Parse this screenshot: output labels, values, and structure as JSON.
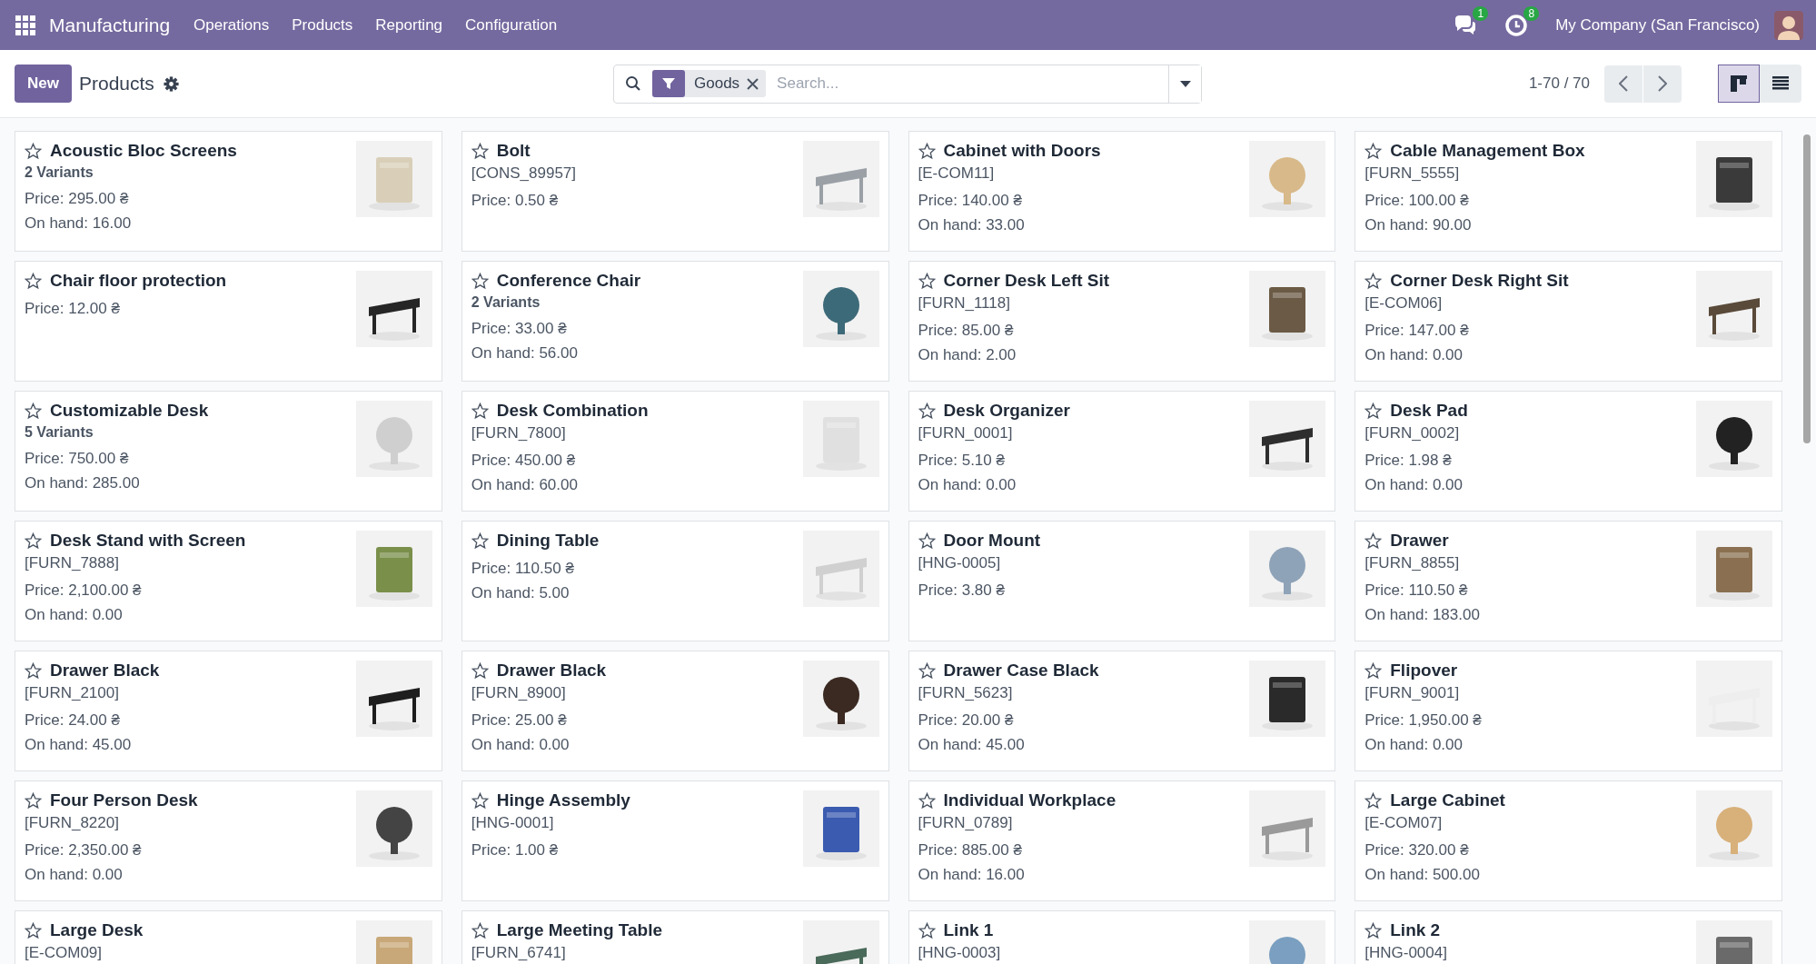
{
  "navbar": {
    "app_name": "Manufacturing",
    "menu": [
      "Operations",
      "Products",
      "Reporting",
      "Configuration"
    ],
    "messages_count": "1",
    "activities_count": "8",
    "company": "My Company (San Francisco)"
  },
  "control_panel": {
    "new_button": "New",
    "breadcrumb": "Products",
    "filter": "Goods",
    "search": {
      "placeholder": "Search..."
    },
    "pager": "1-70 / 70",
    "views": [
      {
        "kind": "kanban",
        "selected": true
      },
      {
        "kind": "list",
        "selected": false
      }
    ]
  },
  "products": [
    {
      "name": "Acoustic Bloc Screens",
      "variants": "2 Variants",
      "price": "Price: 295.00 ₴",
      "on_hand": "On hand: 16.00",
      "favorite": false
    },
    {
      "name": "Bolt",
      "code": "[CONS_89957]",
      "price": "Price: 0.50 ₴",
      "favorite": false
    },
    {
      "name": "Cabinet with Doors",
      "code": "[E-COM11]",
      "price": "Price: 140.00 ₴",
      "on_hand": "On hand: 33.00",
      "favorite": false
    },
    {
      "name": "Cable Management Box",
      "code": "[FURN_5555]",
      "price": "Price: 100.00 ₴",
      "on_hand": "On hand: 90.00",
      "favorite": false
    },
    {
      "name": "Chair floor protection",
      "price": "Price: 12.00 ₴",
      "favorite": false
    },
    {
      "name": "Conference Chair",
      "variants": "2 Variants",
      "price": "Price: 33.00 ₴",
      "on_hand": "On hand: 56.00",
      "favorite": false
    },
    {
      "name": "Corner Desk Left Sit",
      "code": "[FURN_1118]",
      "price": "Price: 85.00 ₴",
      "on_hand": "On hand: 2.00",
      "favorite": false
    },
    {
      "name": "Corner Desk Right Sit",
      "code": "[E-COM06]",
      "price": "Price: 147.00 ₴",
      "on_hand": "On hand: 0.00",
      "favorite": false
    },
    {
      "name": "Customizable Desk",
      "variants": "5 Variants",
      "price": "Price: 750.00 ₴",
      "on_hand": "On hand: 285.00",
      "favorite": false
    },
    {
      "name": "Desk Combination",
      "code": "[FURN_7800]",
      "price": "Price: 450.00 ₴",
      "on_hand": "On hand: 60.00",
      "favorite": false
    },
    {
      "name": "Desk Organizer",
      "code": "[FURN_0001]",
      "price": "Price: 5.10 ₴",
      "on_hand": "On hand: 0.00",
      "favorite": false
    },
    {
      "name": "Desk Pad",
      "code": "[FURN_0002]",
      "price": "Price: 1.98 ₴",
      "on_hand": "On hand: 0.00",
      "favorite": false
    },
    {
      "name": "Desk Stand with Screen",
      "code": "[FURN_7888]",
      "price": "Price: 2,100.00 ₴",
      "on_hand": "On hand: 0.00",
      "favorite": false
    },
    {
      "name": "Dining Table",
      "price": "Price: 110.50 ₴",
      "on_hand": "On hand: 5.00",
      "favorite": false
    },
    {
      "name": "Door Mount",
      "code": "[HNG-0005]",
      "price": "Price: 3.80 ₴",
      "favorite": false
    },
    {
      "name": "Drawer",
      "code": "[FURN_8855]",
      "price": "Price: 110.50 ₴",
      "on_hand": "On hand: 183.00",
      "favorite": false
    },
    {
      "name": "Drawer Black",
      "code": "[FURN_2100]",
      "price": "Price: 24.00 ₴",
      "on_hand": "On hand: 45.00",
      "favorite": false
    },
    {
      "name": "Drawer Black",
      "code": "[FURN_8900]",
      "price": "Price: 25.00 ₴",
      "on_hand": "On hand: 0.00",
      "favorite": false
    },
    {
      "name": "Drawer Case Black",
      "code": "[FURN_5623]",
      "price": "Price: 20.00 ₴",
      "on_hand": "On hand: 45.00",
      "favorite": false
    },
    {
      "name": "Flipover",
      "code": "[FURN_9001]",
      "price": "Price: 1,950.00 ₴",
      "on_hand": "On hand: 0.00",
      "favorite": false
    },
    {
      "name": "Four Person Desk",
      "code": "[FURN_8220]",
      "price": "Price: 2,350.00 ₴",
      "on_hand": "On hand: 0.00",
      "favorite": false
    },
    {
      "name": "Hinge Assembly",
      "code": "[HNG-0001]",
      "price": "Price: 1.00 ₴",
      "favorite": false
    },
    {
      "name": "Individual Workplace",
      "code": "[FURN_0789]",
      "price": "Price: 885.00 ₴",
      "on_hand": "On hand: 16.00",
      "favorite": false
    },
    {
      "name": "Large Cabinet",
      "code": "[E-COM07]",
      "price": "Price: 320.00 ₴",
      "on_hand": "On hand: 500.00",
      "favorite": false
    },
    {
      "name": "Large Desk",
      "code": "[E-COM09]",
      "favorite": false
    },
    {
      "name": "Large Meeting Table",
      "code": "[FURN_6741]",
      "favorite": false
    },
    {
      "name": "Link 1",
      "code": "[HNG-0003]",
      "favorite": false
    },
    {
      "name": "Link 2",
      "code": "[HNG-0004]",
      "favorite": false
    }
  ]
}
